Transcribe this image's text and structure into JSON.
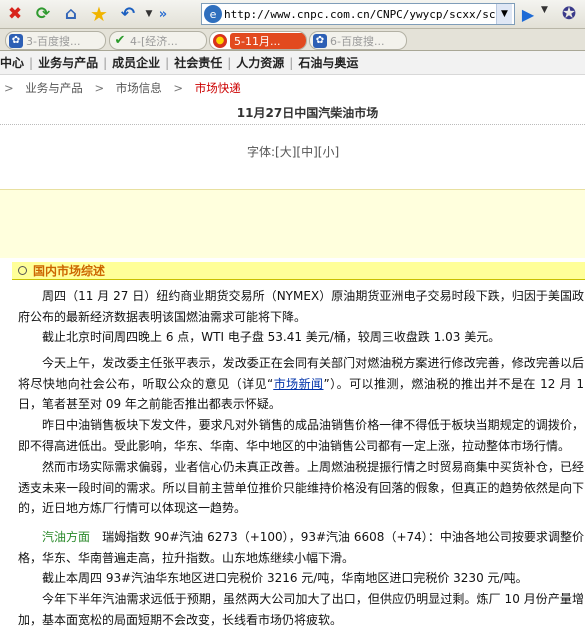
{
  "browser": {
    "url": "http://www.cnpc.com.cn/CNPC/ywycp/scxx/sckd/11",
    "tabs": [
      {
        "label": "3-百度搜..."
      },
      {
        "label": "4-[经济..."
      },
      {
        "label": "5-11月..."
      },
      {
        "label": "6-百度搜..."
      }
    ]
  },
  "site_nav": {
    "items": [
      "中心",
      "业务与产品",
      "成员企业",
      "社会责任",
      "人力资源",
      "石油与奥运"
    ]
  },
  "breadcrumb": {
    "items": [
      "业务与产品",
      "市场信息",
      "市场快递"
    ]
  },
  "article": {
    "title": "11月27日中国汽柴油市场",
    "font_size_label": "字体:",
    "font_sizes": [
      "[大]",
      "[中]",
      "[小]"
    ],
    "section_title": "国内市场综述",
    "p1": "周四（11 月 27 日）纽约商业期货交易所（NYMEX）原油期货亚洲电子交易时段下跌，归因于美国政府公布的最新经济数据表明该国燃油需求可能将下降。",
    "p2": "截止北京时间周四晚上 6 点，WTI 电子盘 53.41 美元/桶，较周三收盘跌 1.03 美元。",
    "p3_before": "今天上午，发改委主任张平表示，发改委正在会同有关部门对燃油税方案进行修改完善，修改完善以后将尽快地向社会公布，听取公众的意见（详见“",
    "p3_link": "市场新闻",
    "p3_after": "”）。可以推测，燃油税的推出并不是在 12 月 1 日，笔者甚至对 09 年之前能否推出都表示怀疑。",
    "p4": "昨日中油销售板块下发文件，要求凡对外销售的成品油销售价格一律不得低于板块当期规定的调拨价，即不得高进低出。受此影响，华东、华南、华中地区的中油销售公司都有一定上涨，拉动整体市场行情。",
    "p5": "然而市场实际需求偏弱，业者信心仍未真正改善。上周燃油税提振行情之时贸易商集中买货补仓，已经透支未来一段时间的需求。所以目前主营单位推价只能维持价格没有回落的假象，但真正的趋势依然是向下的，近日地方炼厂行情可以体现这一趋势。",
    "p6_label": "汽油方面",
    "p6_text": "瑞姆指数 90#汽油 6273（+100），93#汽油 6608（+74）：中油各地公司按要求调整价格，华东、华南普遍走高，拉升指数。山东地炼继续小幅下滑。",
    "p7": "截止本周四 93#汽油华东地区进口完税价 3216 元/吨，华南地区进口完税价 3230 元/吨。",
    "p8": "今年下半年汽油需求远低于预期，虽然两大公司加大了出口，但供应仍明显过剩。炼厂 10 月份产量增加，基本面宽松的局面短期不会改变，长线看市场仍将疲软。"
  }
}
